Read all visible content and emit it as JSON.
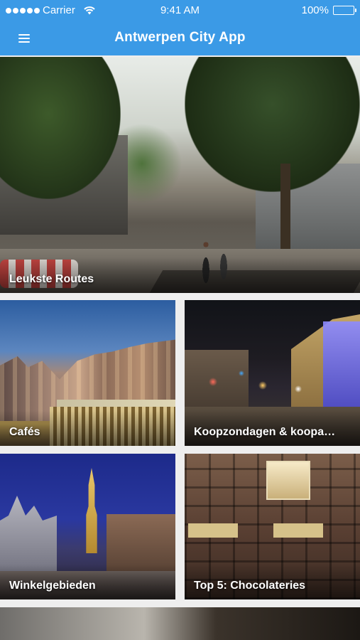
{
  "status_bar": {
    "carrier": "Carrier",
    "time": "9:41 AM",
    "battery": "100%",
    "icons": [
      "signal-dots-icon",
      "wifi-icon",
      "battery-icon"
    ]
  },
  "nav_bar": {
    "title": "Antwerpen City App",
    "menu_icon": "hamburger-menu-icon",
    "color": "#3b9ae6"
  },
  "cards": [
    {
      "label": "Leukste Routes"
    },
    {
      "label": "Cafés"
    },
    {
      "label": "Koopzondagen & koopa…"
    },
    {
      "label": "Winkelgebieden"
    },
    {
      "label": "Top 5: Chocolateries"
    }
  ],
  "colors": {
    "accent": "#3b9ae6",
    "background": "#eeeeee",
    "label_text": "#ffffff"
  }
}
